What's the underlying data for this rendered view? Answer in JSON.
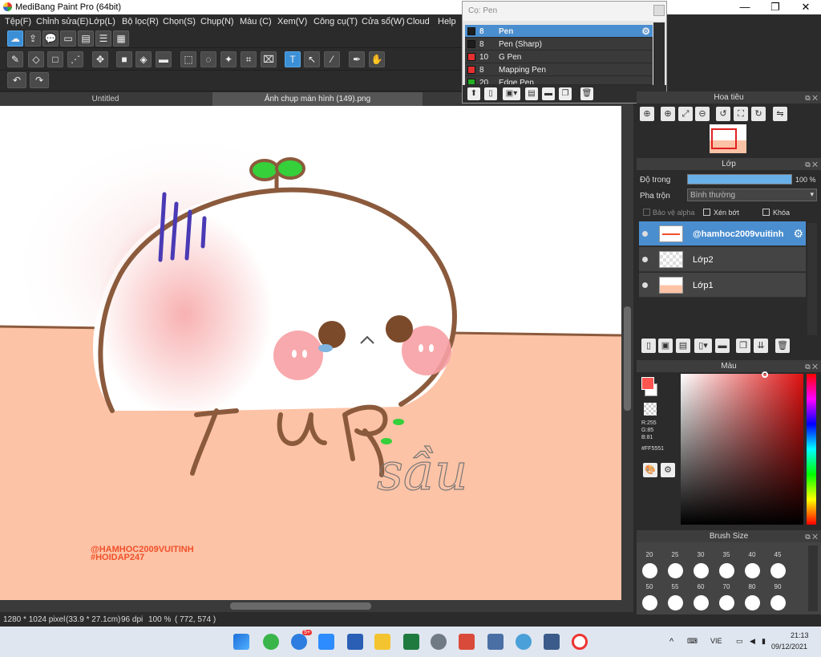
{
  "window": {
    "title": "MediBang Paint Pro (64bit)",
    "minimize": "—",
    "maximize": "❐",
    "close": "✕"
  },
  "menu": [
    "Tệp(F)",
    "Chỉnh sửa(E)",
    "Lớp(L)",
    "Bộ lọc(R)",
    "Chọn(S)",
    "Chụp(N)",
    "Màu (C)",
    "Xem(V)",
    "Công cụ(T)",
    "Cửa sổ(W)",
    "Cloud",
    "Help"
  ],
  "tabs": [
    {
      "label": "Untitled"
    },
    {
      "label": "Ảnh chụp màn hình (149).png"
    }
  ],
  "brush_popup": {
    "header": "Cọ: Pen",
    "items": [
      {
        "size": "8",
        "name": "Pen",
        "color": "#1e1e1e"
      },
      {
        "size": "8",
        "name": "Pen (Sharp)",
        "color": "#1e1e1e"
      },
      {
        "size": "10",
        "name": "G Pen",
        "color": "#e53030"
      },
      {
        "size": "8",
        "name": "Mapping Pen",
        "color": "#e53030"
      },
      {
        "size": "20",
        "name": "Edge Pen",
        "color": "#22b022"
      }
    ]
  },
  "canvas": {
    "handwriting": "sầu",
    "watermark_line1": "@HAMHOC2009VUITINH",
    "watermark_line2": "#HOIDAP247"
  },
  "status": {
    "dimensions": "1280 * 1024 pixel",
    "size_cm": "(33.9 * 27.1cm)",
    "dpi": "96 dpi",
    "zoom": "100 %",
    "cursor": "( 772, 574 )"
  },
  "navigator": {
    "title": "Hoa tiêu"
  },
  "layers": {
    "title": "Lớp",
    "opacity_label": "Độ trong",
    "opacity_value": "100 %",
    "opacity_fraction": 1.0,
    "blend_label": "Pha trộn",
    "blend_value": "Bình thường",
    "protect_alpha": "Bảo vệ alpha",
    "clipping": "Xén bớt",
    "lock": "Khóa",
    "items": [
      {
        "name": "@hamhoc2009vuitinh",
        "selected": true
      },
      {
        "name": "Lớp2",
        "selected": false
      },
      {
        "name": "Lớp1",
        "selected": false
      }
    ]
  },
  "color": {
    "title": "Màu",
    "r": "R:255",
    "g": "G:85",
    "b": "B:81",
    "hex": "#FF5551",
    "fg_color": "#ff5551"
  },
  "brush_size": {
    "title": "Brush Size",
    "row1": [
      "20",
      "25",
      "30",
      "35",
      "40",
      "45"
    ],
    "row2": [
      "50",
      "55",
      "60",
      "70",
      "80",
      "90"
    ]
  },
  "taskbar": {
    "lang": "VIE",
    "time": "21:13",
    "date": "09/12/2021",
    "zalo_badge": "5+"
  }
}
